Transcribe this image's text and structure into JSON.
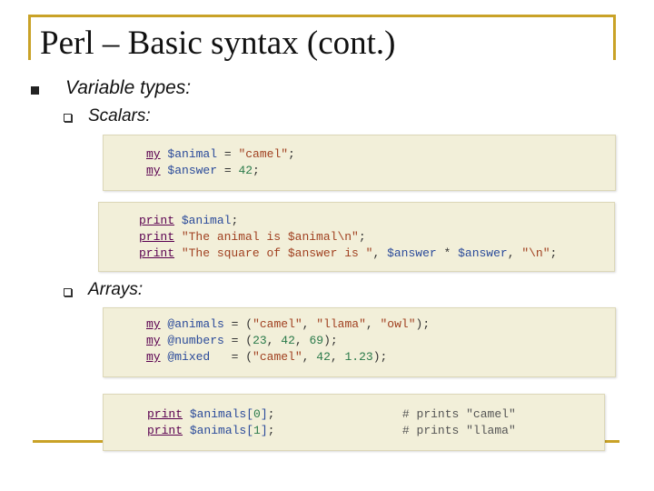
{
  "slide": {
    "title": "Perl – Basic syntax (cont.)",
    "bullet1": "Variable types:",
    "sub1": "Scalars:",
    "sub2": "Arrays:"
  },
  "code1": [
    [
      [
        "my",
        "kw"
      ],
      [
        " ",
        ""
      ],
      [
        "$animal",
        "var"
      ],
      [
        " = ",
        "op"
      ],
      [
        "\"camel\"",
        "str"
      ],
      [
        ";",
        "op"
      ]
    ],
    [
      [
        "my",
        "kw"
      ],
      [
        " ",
        ""
      ],
      [
        "$answer",
        "var"
      ],
      [
        " = ",
        "op"
      ],
      [
        "42",
        "num"
      ],
      [
        ";",
        "op"
      ]
    ]
  ],
  "code2": [
    [
      [
        "print",
        "kw"
      ],
      [
        " ",
        ""
      ],
      [
        "$animal",
        "var"
      ],
      [
        ";",
        "op"
      ]
    ],
    [
      [
        "print",
        "kw"
      ],
      [
        " ",
        ""
      ],
      [
        "\"The animal is $animal\\n\"",
        "str"
      ],
      [
        ";",
        "op"
      ]
    ],
    [
      [
        "print",
        "kw"
      ],
      [
        " ",
        ""
      ],
      [
        "\"The square of $answer is \"",
        "str"
      ],
      [
        ", ",
        "op"
      ],
      [
        "$answer",
        "var"
      ],
      [
        " * ",
        "op"
      ],
      [
        "$answer",
        "var"
      ],
      [
        ", ",
        "op"
      ],
      [
        "\"\\n\"",
        "str"
      ],
      [
        ";",
        "op"
      ]
    ]
  ],
  "code3": [
    [
      [
        "my",
        "kw"
      ],
      [
        " ",
        ""
      ],
      [
        "@animals",
        "var"
      ],
      [
        " = (",
        "op"
      ],
      [
        "\"camel\"",
        "str"
      ],
      [
        ", ",
        "op"
      ],
      [
        "\"llama\"",
        "str"
      ],
      [
        ", ",
        "op"
      ],
      [
        "\"owl\"",
        "str"
      ],
      [
        ");",
        "op"
      ]
    ],
    [
      [
        "my",
        "kw"
      ],
      [
        " ",
        ""
      ],
      [
        "@numbers",
        "var"
      ],
      [
        " = (",
        "op"
      ],
      [
        "23",
        "num"
      ],
      [
        ", ",
        "op"
      ],
      [
        "42",
        "num"
      ],
      [
        ", ",
        "op"
      ],
      [
        "69",
        "num"
      ],
      [
        ");",
        "op"
      ]
    ],
    [
      [
        "my",
        "kw"
      ],
      [
        " ",
        ""
      ],
      [
        "@mixed",
        "var"
      ],
      [
        "   = (",
        "op"
      ],
      [
        "\"camel\"",
        "str"
      ],
      [
        ", ",
        "op"
      ],
      [
        "42",
        "num"
      ],
      [
        ", ",
        "op"
      ],
      [
        "1.23",
        "num"
      ],
      [
        ");",
        "op"
      ]
    ]
  ],
  "code4": [
    [
      [
        "print",
        "kw"
      ],
      [
        " ",
        ""
      ],
      [
        "$animals[",
        "var"
      ],
      [
        "0",
        "num"
      ],
      [
        "]",
        "var"
      ],
      [
        ";",
        "op"
      ],
      [
        "                  ",
        ""
      ],
      [
        "# prints \"camel\"",
        "cmt"
      ]
    ],
    [
      [
        "print",
        "kw"
      ],
      [
        " ",
        ""
      ],
      [
        "$animals[",
        "var"
      ],
      [
        "1",
        "num"
      ],
      [
        "]",
        "var"
      ],
      [
        ";",
        "op"
      ],
      [
        "                  ",
        ""
      ],
      [
        "# prints \"llama\"",
        "cmt"
      ]
    ]
  ],
  "colors": {
    "accent": "#c9a227",
    "code_bg": "#f2efd9"
  }
}
